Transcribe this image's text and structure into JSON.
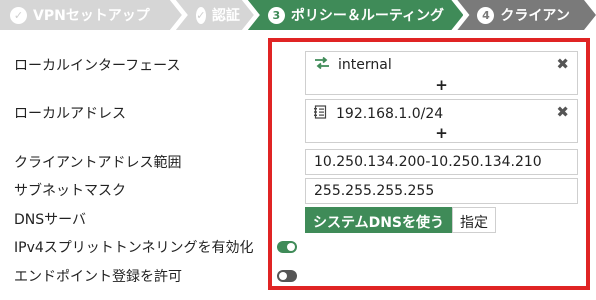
{
  "wizard": {
    "steps": [
      {
        "icon": "✓",
        "label": "VPNセットアップ",
        "state": "done"
      },
      {
        "icon": "✓",
        "label": "認証",
        "state": "done"
      },
      {
        "icon": "3",
        "label": "ポリシー＆ルーティング",
        "state": "active"
      },
      {
        "icon": "4",
        "label": "クライアン",
        "state": "todo"
      }
    ]
  },
  "form": {
    "local_interface": {
      "label": "ローカルインターフェース",
      "value": "internal",
      "icon": "interface-icon"
    },
    "local_address": {
      "label": "ローカルアドレス",
      "value": "192.168.1.0/24",
      "icon": "address-icon"
    },
    "client_address_range": {
      "label": "クライアントアドレス範囲",
      "value": "10.250.134.200-10.250.134.210"
    },
    "subnet_mask": {
      "label": "サブネットマスク",
      "value": "255.255.255.255"
    },
    "dns_server": {
      "label": "DNSサーバ",
      "options": [
        "システムDNSを使う",
        "指定"
      ],
      "selected": "システムDNSを使う"
    },
    "ipv4_split_tunneling": {
      "label": "IPv4スプリットトンネリングを有効化",
      "enabled": true
    },
    "endpoint_registration": {
      "label": "エンドポイント登録を許可",
      "enabled": false
    },
    "add_symbol": "+",
    "remove_symbol": "✖"
  },
  "colors": {
    "accent": "#3f8b58",
    "highlight": "#e02424",
    "step_done": "#d6d6d6",
    "step_todo": "#7a7a7a"
  }
}
